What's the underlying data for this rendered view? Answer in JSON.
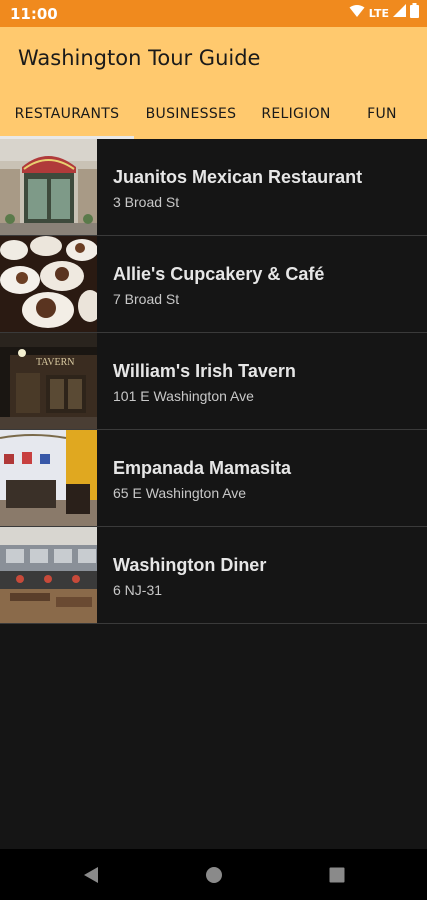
{
  "status_bar": {
    "time": "11:00",
    "network": "LTE"
  },
  "app": {
    "title": "Washington Tour Guide"
  },
  "tabs": [
    {
      "label": "RESTAURANTS",
      "selected": true
    },
    {
      "label": "BUSINESSES",
      "selected": false
    },
    {
      "label": "RELIGION",
      "selected": false
    },
    {
      "label": "FUN",
      "selected": false
    }
  ],
  "places": [
    {
      "name": "Juanitos Mexican Restaurant",
      "address": "3 Broad St"
    },
    {
      "name": "Allie's Cupcakery & Café",
      "address": "7 Broad St"
    },
    {
      "name": "William's Irish Tavern",
      "address": "101 E Washington Ave"
    },
    {
      "name": "Empanada Mamasita",
      "address": "65 E Washington Ave"
    },
    {
      "name": "Washington Diner",
      "address": "6 NJ-31"
    }
  ],
  "thumbnail_signs": {
    "tavern": "TAVERN"
  },
  "colors": {
    "status_bar": "#f08a1e",
    "app_bar": "#ffc96e",
    "background": "#151515"
  },
  "icons": [
    "wifi-icon",
    "signal-icon",
    "battery-icon",
    "back-icon",
    "home-icon",
    "recents-icon"
  ]
}
